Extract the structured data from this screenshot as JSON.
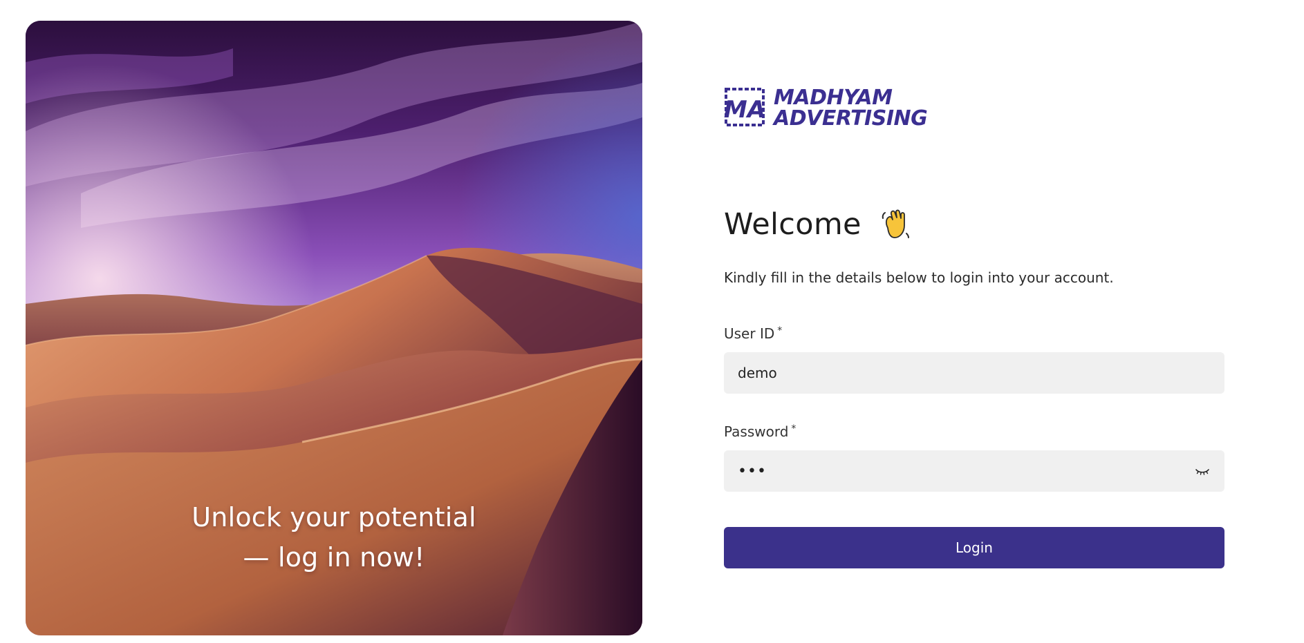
{
  "hero": {
    "caption_line1": "Unlock your potential",
    "caption_line2": "— log in now!",
    "image_icon": "desert-dunes-image"
  },
  "logo": {
    "line1": "MADHYAM",
    "line2": "ADVERTISING",
    "mark_letters": "MA",
    "color": "#3b2f91"
  },
  "welcome": {
    "title": "Welcome",
    "emoji_icon": "waving-hand-icon",
    "subtitle": "Kindly fill in the details below to login into your account."
  },
  "form": {
    "user_id": {
      "label": "User ID",
      "required_mark": "*",
      "value": "demo"
    },
    "password": {
      "label": "Password",
      "required_mark": "*",
      "value": "•••",
      "toggle_icon": "eye-closed-icon"
    },
    "login_label": "Login"
  },
  "colors": {
    "accent": "#3b318b",
    "input_bg": "#f0f0f0"
  }
}
